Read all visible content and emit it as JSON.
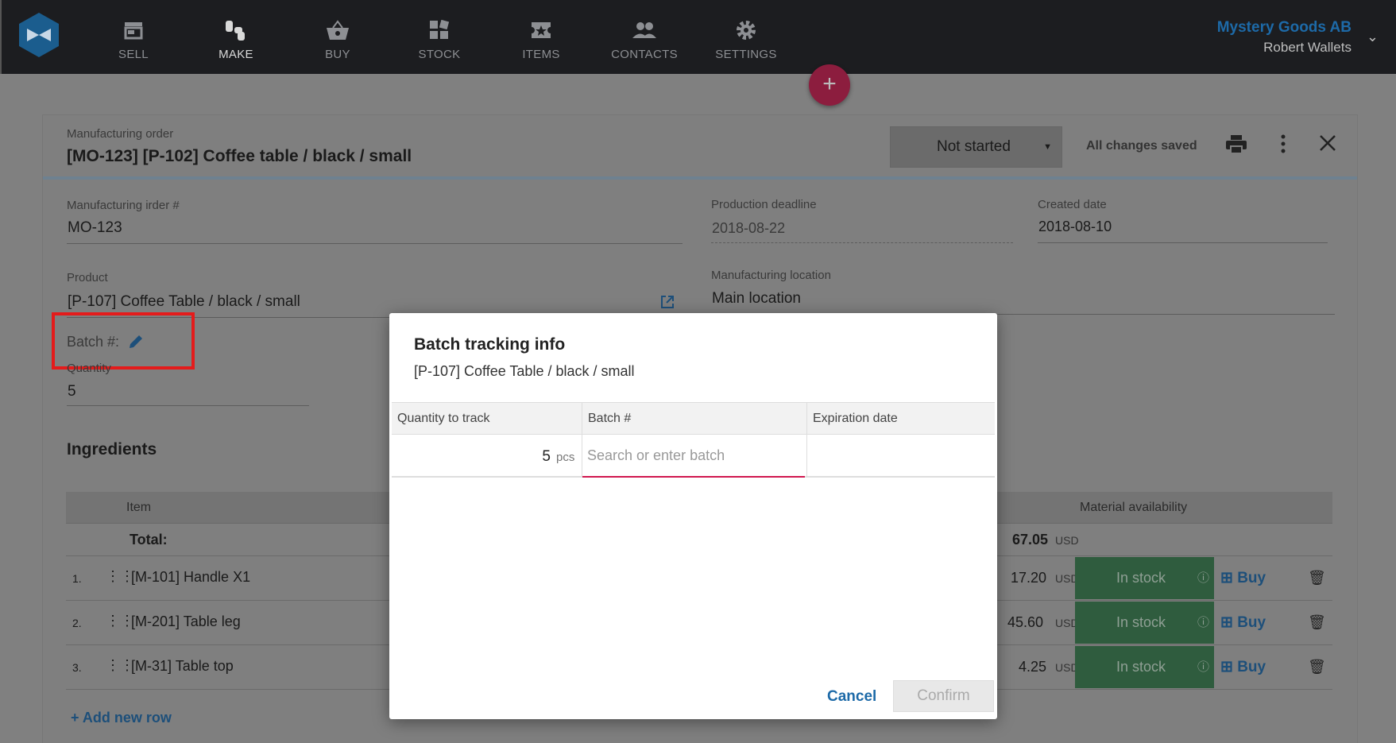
{
  "nav": {
    "items": [
      {
        "label": "SELL",
        "icon": "store-icon"
      },
      {
        "label": "MAKE",
        "icon": "hands-icon",
        "active": true
      },
      {
        "label": "BUY",
        "icon": "basket-icon"
      },
      {
        "label": "STOCK",
        "icon": "boxes-icon"
      },
      {
        "label": "ITEMS",
        "icon": "ticket-star-icon"
      },
      {
        "label": "CONTACTS",
        "icon": "people-icon"
      },
      {
        "label": "SETTINGS",
        "icon": "gear-icon"
      }
    ],
    "company": "Mystery Goods AB",
    "user": "Robert Wallets"
  },
  "order": {
    "caption": "Manufacturing order",
    "title": "[MO-123]  [P-102] Coffee table / black / small",
    "status": "Not started",
    "save_state": "All changes saved",
    "fields": {
      "mo_label": "Manufacturing irder #",
      "mo_value": "MO-123",
      "deadline_label": "Production deadline",
      "deadline_value": "2018-08-22",
      "created_label": "Created date",
      "created_value": "2018-08-10",
      "product_label": "Product",
      "product_value": "[P-107] Coffee Table / black / small",
      "location_label": "Manufacturing location",
      "location_value": "Main location",
      "batch_label": "Batch #:",
      "quantity_label": "Quantity",
      "quantity_value": "5"
    }
  },
  "ingredients": {
    "title": "Ingredients",
    "headers": {
      "item": "Item",
      "availability": "Material availability"
    },
    "total_label": "Total:",
    "total_value": "67.05",
    "currency": "USD",
    "rows": [
      {
        "num": "1.",
        "item": "[M-101] Handle X1",
        "cost": "17.20",
        "status": "In stock",
        "buy": "Buy"
      },
      {
        "num": "2.",
        "item": "[M-201] Table leg",
        "cost": "45.60",
        "status": "In stock",
        "buy": "Buy"
      },
      {
        "num": "3.",
        "item": "[M-31] Table top",
        "cost": "4.25",
        "status": "In stock",
        "buy": "Buy"
      }
    ],
    "add_row": "+ Add new row"
  },
  "modal": {
    "title": "Batch tracking info",
    "subtitle": "[P-107] Coffee Table / black / small",
    "headers": {
      "qty": "Quantity to track",
      "batch": "Batch #",
      "expiry": "Expiration date"
    },
    "qty_value": "5",
    "qty_unit": "pcs",
    "batch_placeholder": "Search or enter batch",
    "cancel": "Cancel",
    "confirm": "Confirm"
  },
  "colors": {
    "accent": "#1d6aa8",
    "in_stock": "#2f5c3e",
    "highlight": "#e41b1b",
    "fab": "#c42a5a"
  }
}
